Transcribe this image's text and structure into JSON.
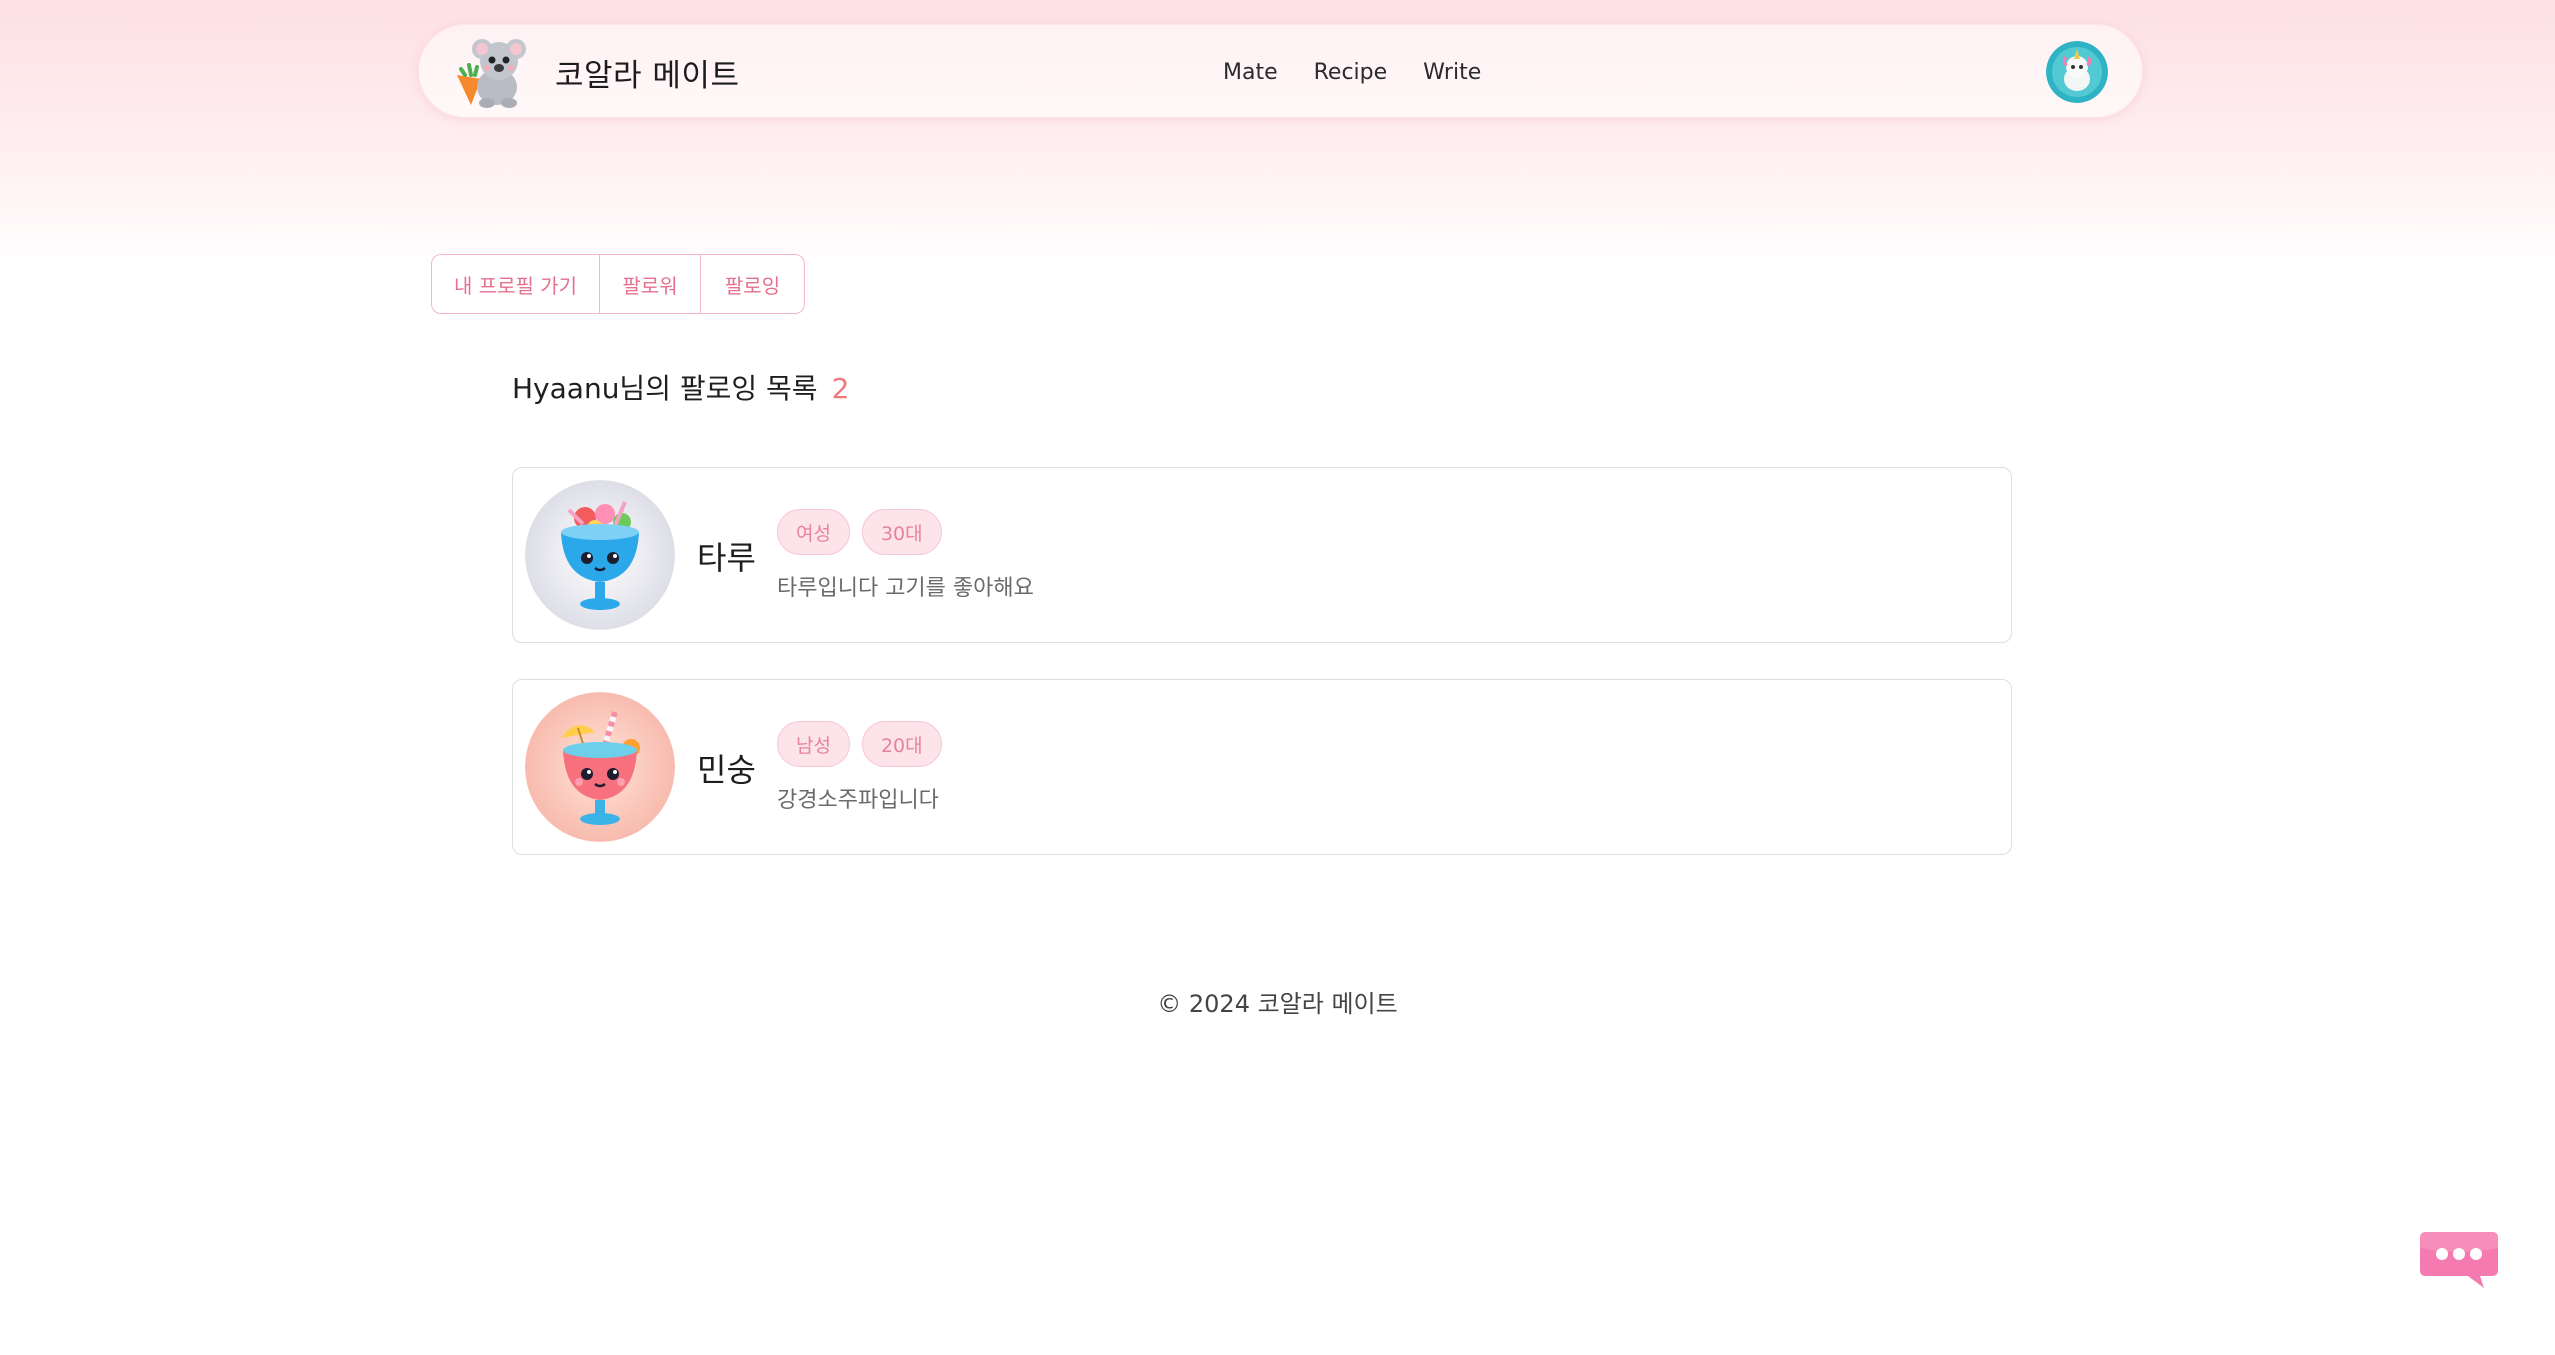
{
  "navbar": {
    "brand_name": "코알라 메이트",
    "logo_icon": "koala-mascot-icon",
    "links": [
      {
        "label": "Mate"
      },
      {
        "label": "Recipe"
      },
      {
        "label": "Write"
      }
    ],
    "avatar_icon": "user-avatar-unicorn"
  },
  "tabs": [
    {
      "label": "내 프로필 가기"
    },
    {
      "label": "팔로워"
    },
    {
      "label": "팔로잉"
    }
  ],
  "following": {
    "heading": "Hyaanu님의 팔로잉 목록",
    "count": "2",
    "users": [
      {
        "name": "타루",
        "gender": "여성",
        "age": "30대",
        "bio": "타루입니다 고기를 좋아해요",
        "avatar_icon": "blue-cocktail-avatar"
      },
      {
        "name": "민숭",
        "gender": "남성",
        "age": "20대",
        "bio": "강경소주파입니다",
        "avatar_icon": "pink-cocktail-avatar"
      }
    ]
  },
  "footer": {
    "copyright": "© 2024 코알라 메이트"
  },
  "chat": {
    "icon": "chat-bubble-icon"
  },
  "colors": {
    "accent_pink": "#e5708f",
    "count_color": "#f0787d",
    "badge_bg": "#fde3ea"
  }
}
